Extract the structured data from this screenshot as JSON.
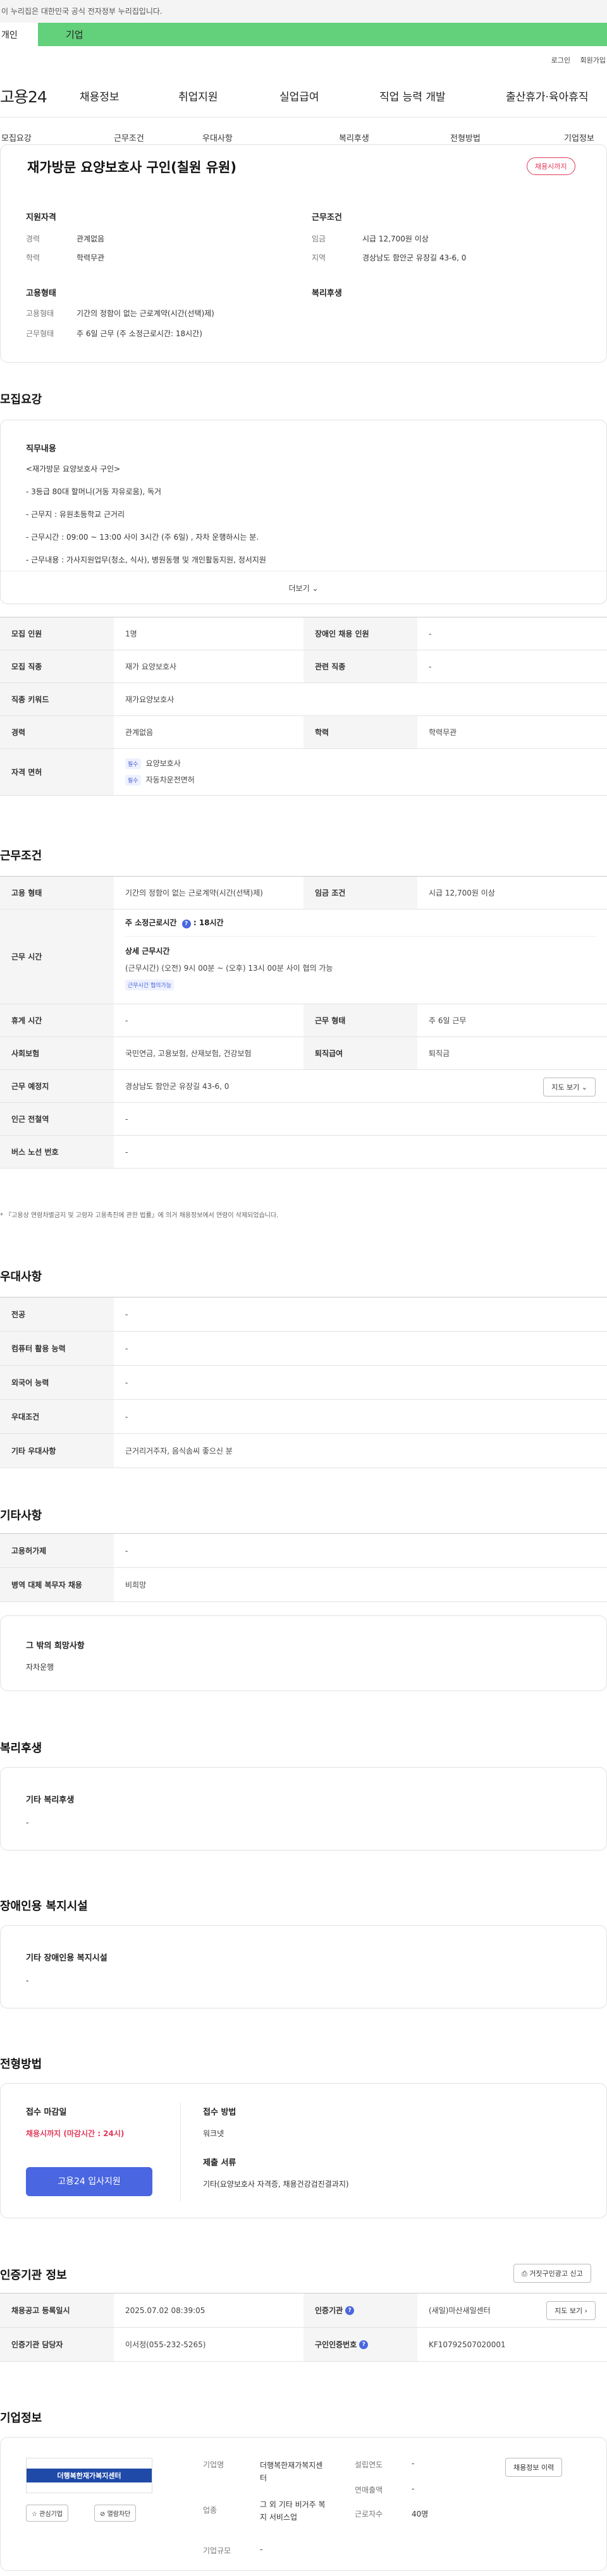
{
  "gov_banner": "이 누리집은 대한민국 공식 전자정부 누리집입니다.",
  "top_tabs": {
    "personal": "개인",
    "company": "기업"
  },
  "util": {
    "login": "로그인",
    "join": "회원가입"
  },
  "logo": "고용24",
  "gnb": [
    "채용정보",
    "취업지원",
    "실업급여",
    "직업 능력 개발",
    "출산휴가·육아휴직"
  ],
  "snb": [
    "모집요강",
    "근무조건",
    "우대사항",
    "복리후생",
    "전형방법",
    "기업정보"
  ],
  "job_title": "재가방문 요양보호사 구인(칠원 유원)",
  "status_badge": "채용시까지",
  "summary": {
    "qual_title": "지원자격",
    "career_k": "경력",
    "career_v": "관계없음",
    "edu_k": "학력",
    "edu_v": "학력무관",
    "cond_title": "근무조건",
    "wage_k": "임금",
    "wage_v": "시급 12,700원 이상",
    "area_k": "지역",
    "area_v": "경상남도 함안군 유장길 43-6, 0",
    "emp_title": "고용형태",
    "type_k": "고용형태",
    "type_v": "기간의 정함이 없는 근로계약(시간(선택)제)",
    "hours_k": "근무형태",
    "hours_v": "주 6일 근무 (주 소정근로시간: 18시간)",
    "welfare_title": "복리후생"
  },
  "recruit": {
    "heading": "모집요강",
    "duty_title": "직무내용",
    "lines": [
      "<재가방문 요양보호사 구인>",
      "- 3등급 80대 할머니(거동 자유로움), 독거",
      "- 근무지 : 유원초등학교 근거리",
      "- 근무시간 :  09:00 ~ 13:00 사이 3시간 (주 6일) , 자차 운행하시는 분.",
      "- 근무내용 : 가사지원업무(청소, 식사), 병원동행 및 개인활동지원, 정서지원"
    ],
    "more": "더보기",
    "table": [
      {
        "k1": "모집 인원",
        "v1": "1명",
        "k2": "장애인 채용 인원",
        "v2": "-"
      },
      {
        "k1": "모집 직종",
        "v1": "재가 요양보호사",
        "k2": "관련 직종",
        "v2": "-"
      },
      {
        "k1": "직종 키워드",
        "v1": "재가요양보호사"
      },
      {
        "k1": "경력",
        "v1": "관계없음",
        "k2": "학력",
        "v2": "학력무관"
      }
    ],
    "license_k": "자격 면허",
    "license_tag": "필수",
    "licenses": [
      "요양보호사",
      "자동차운전면허"
    ]
  },
  "conditions": {
    "heading": "근무조건",
    "emp_k": "고용 형태",
    "emp_v": "기간의 정함이 없는 근로계약(시간(선택)제)",
    "wage_k": "임금 조건",
    "wage_v": "시급 12,700원 이상",
    "time_k": "근무 시간",
    "weekly": "주 소정근로시간",
    "weekly_v": ": 18시간",
    "detail_title": "상세 근무시간",
    "detail_v": "(근무시간) (오전) 9시 00분 ~ (오후) 13시 00분 사이 협의 가능",
    "flex_tag": "근무시간 협의가능",
    "rest_k": "휴게 시간",
    "rest_v": "-",
    "form_k": "근무 형태",
    "form_v": "주 6일 근무",
    "ins_k": "사회보험",
    "ins_v": "국민연금, 고용보험, 산재보험, 건강보험",
    "ret_k": "퇴직급여",
    "ret_v": "퇴직금",
    "place_k": "근무 예정지",
    "place_v": "경상남도 함안군 유장길 43-6, 0",
    "map_btn": "지도 보기",
    "subway_k": "인근 전철역",
    "subway_v": "-",
    "bus_k": "버스 노선 번호",
    "bus_v": "-",
    "note": "* 『고용상 연령차별금지 및 고령자 고용촉진에 관한 법률』에 의거 채용정보에서 연령이 삭제되었습니다."
  },
  "preference": {
    "heading": "우대사항",
    "rows": [
      [
        "전공",
        "-"
      ],
      [
        "컴퓨터 활용 능력",
        "-"
      ],
      [
        "외국어 능력",
        "-"
      ],
      [
        "우대조건",
        "-"
      ],
      [
        "기타 우대사항",
        "근거리거주자, 음식솜씨 좋으신 분"
      ]
    ]
  },
  "etc": {
    "heading": "기타사항",
    "rows": [
      [
        "고용허가제",
        "-"
      ],
      [
        "병역 대체 복무자 채용",
        "비희망"
      ]
    ],
    "hope_title": "그 밖의 희망사항",
    "hope_v": "자차운행"
  },
  "welfare": {
    "heading": "복리후생",
    "title": "기타 복리후생",
    "v": "-"
  },
  "disability": {
    "heading": "장애인용 복지시설",
    "title": "기타 장애인용 복지시설",
    "v": "-"
  },
  "selection": {
    "heading": "전형방법",
    "deadline_title": "접수 마감일",
    "deadline_v": "채용시까지 (마감시간 : 24시)",
    "apply_btn": "고용24 입사지원",
    "method_title": "접수 방법",
    "method_v": "워크넷",
    "docs_title": "제출 서류",
    "docs_v": "기타(요양보호사 자격증, 채용건강검진결과지)"
  },
  "cert": {
    "heading": "인증기관 정보",
    "report_btn": "거짓구인광고 신고",
    "reg_k": "채용공고 등록일시",
    "reg_v": "2025.07.02 08:39:05",
    "agency_k": "인증기관",
    "agency_v": "(새일)마산새일센터",
    "map_btn": "지도 보기",
    "staff_k": "인증기관 담당자",
    "staff_v": "이서정(055-232-5265)",
    "num_k": "구인인증번호",
    "num_v": "KF10792507020001"
  },
  "company": {
    "heading": "기업정보",
    "logo_text": "더행복한재가복지센터",
    "interest_btn": "관심기업",
    "block_btn": "열람차단",
    "name_k": "기업명",
    "name_v": "더행복한재가복지센터",
    "year_k": "설립연도",
    "year_v": "-",
    "biz_k": "업종",
    "biz_v": "그 외 기타 비거주 복지 서비스업",
    "sales_k": "연매출액",
    "sales_v": "-",
    "emp_k": "근로자수",
    "emp_v": "40명",
    "scale_k": "기업규모",
    "scale_v": "-",
    "jobs_btn": "채용정보 이력"
  }
}
